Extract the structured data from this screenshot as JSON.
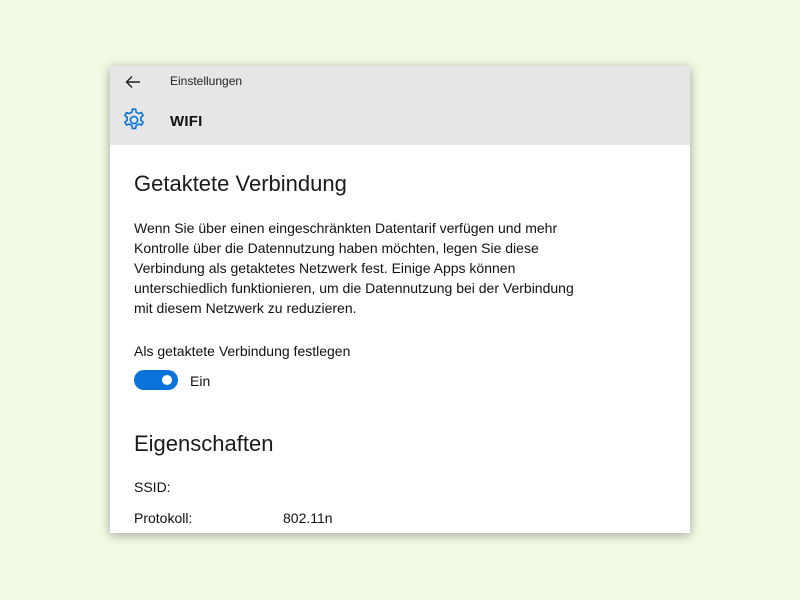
{
  "window": {
    "app_title": "Einstellungen",
    "page_title": "WIFI",
    "icons": {
      "back": "back-arrow-icon",
      "settings": "gear-icon"
    },
    "accent_color": "#0a74da"
  },
  "metered": {
    "heading": "Getaktete Verbindung",
    "description": "Wenn Sie über einen eingeschränkten Datentarif verfügen und mehr Kontrolle über die Datennutzung haben möchten, legen Sie diese Verbindung als getaktetes Netzwerk fest. Einige Apps können unterschiedlich funktionieren, um die Datennutzung bei der Verbindung mit diesem Netzwerk zu reduzieren.",
    "toggle_label": "Als getaktete Verbindung festlegen",
    "toggle_on": true,
    "toggle_state_label": "Ein"
  },
  "properties": {
    "heading": "Eigenschaften",
    "items": [
      {
        "label": "SSID:",
        "value": ""
      },
      {
        "label": "Protokoll:",
        "value": "802.11n"
      }
    ]
  }
}
